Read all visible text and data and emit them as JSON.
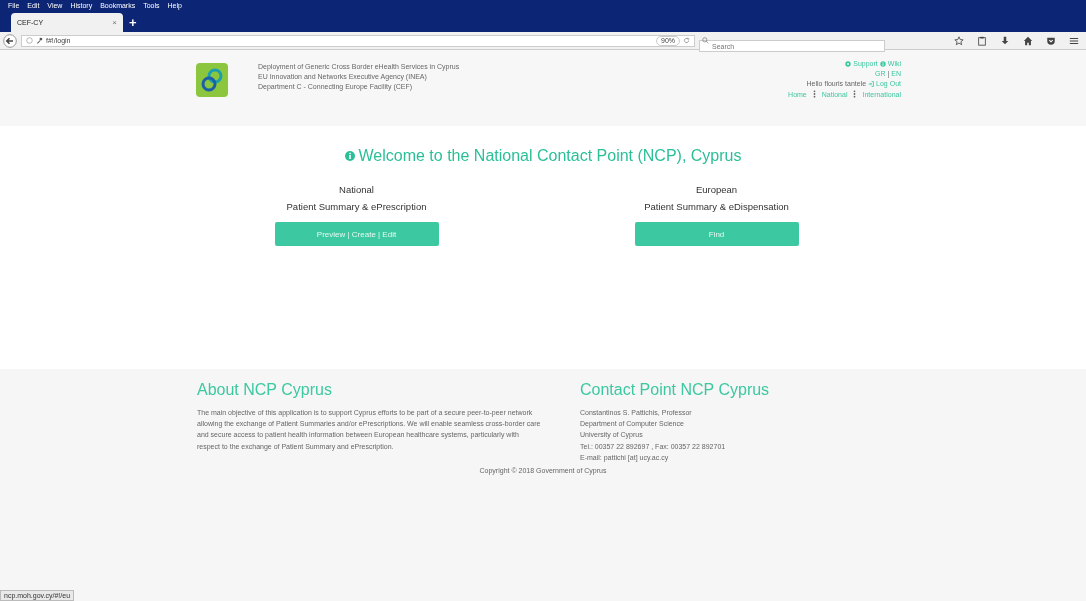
{
  "browser": {
    "menu": [
      "File",
      "Edit",
      "View",
      "History",
      "Bookmarks",
      "Tools",
      "Help"
    ],
    "tabs": [
      {
        "label": "CEF-CY",
        "selected": true
      }
    ],
    "tab_close": "×",
    "new_tab": "+",
    "url": "f#!/login",
    "zoom": "90%",
    "search": {
      "placeholder": "Search"
    },
    "status_url": "ncp.moh.gov.cy/#!/eu"
  },
  "header": {
    "lines": [
      "Deployment of Generic Cross Border eHealth Services in Cyprus",
      "EU Innovation and Networks Executive Agency (INEA)",
      "Department C - Connecting Europe Facility (CEF)"
    ],
    "support": "Support",
    "wiki": "Wiki",
    "lang_gr": "GR",
    "lang_sep": "|",
    "lang_en": "EN",
    "greeting": "Hello flouris tantele",
    "logout": "Log Out",
    "nav": [
      "Home",
      "National",
      "International"
    ]
  },
  "welcome": "Welcome to the National Contact Point (NCP), Cyprus",
  "services": [
    {
      "title": "National",
      "subtitle": "Patient Summary & ePrescription",
      "button": "Preview | Create | Edit"
    },
    {
      "title": "European",
      "subtitle": "Patient Summary & eDispensation",
      "button": "Find"
    }
  ],
  "about": {
    "heading": "About NCP Cyprus",
    "text": "The main objective of this application is to support Cyprus efforts to be part of a secure peer-to-peer network allowing the exchange of Patient Summaries and/or ePrescriptions. We will enable seamless cross-border care and secure access to patient health information between European healthcare systems, particularly with respect to the exchange of Patient Summary and ePrescription."
  },
  "contact": {
    "heading": "Contact Point NCP Cyprus",
    "lines": [
      "Constantinos S. Pattichis, Professor",
      "Department of Computer Science",
      "University of Cyprus",
      "Tel.: 00357 22 892697 , Fax: 00357 22 892701",
      "E-mail: pattichi [at] ucy.ac.cy"
    ]
  },
  "copyright": "Copyright © 2018 Government of Cyprus"
}
